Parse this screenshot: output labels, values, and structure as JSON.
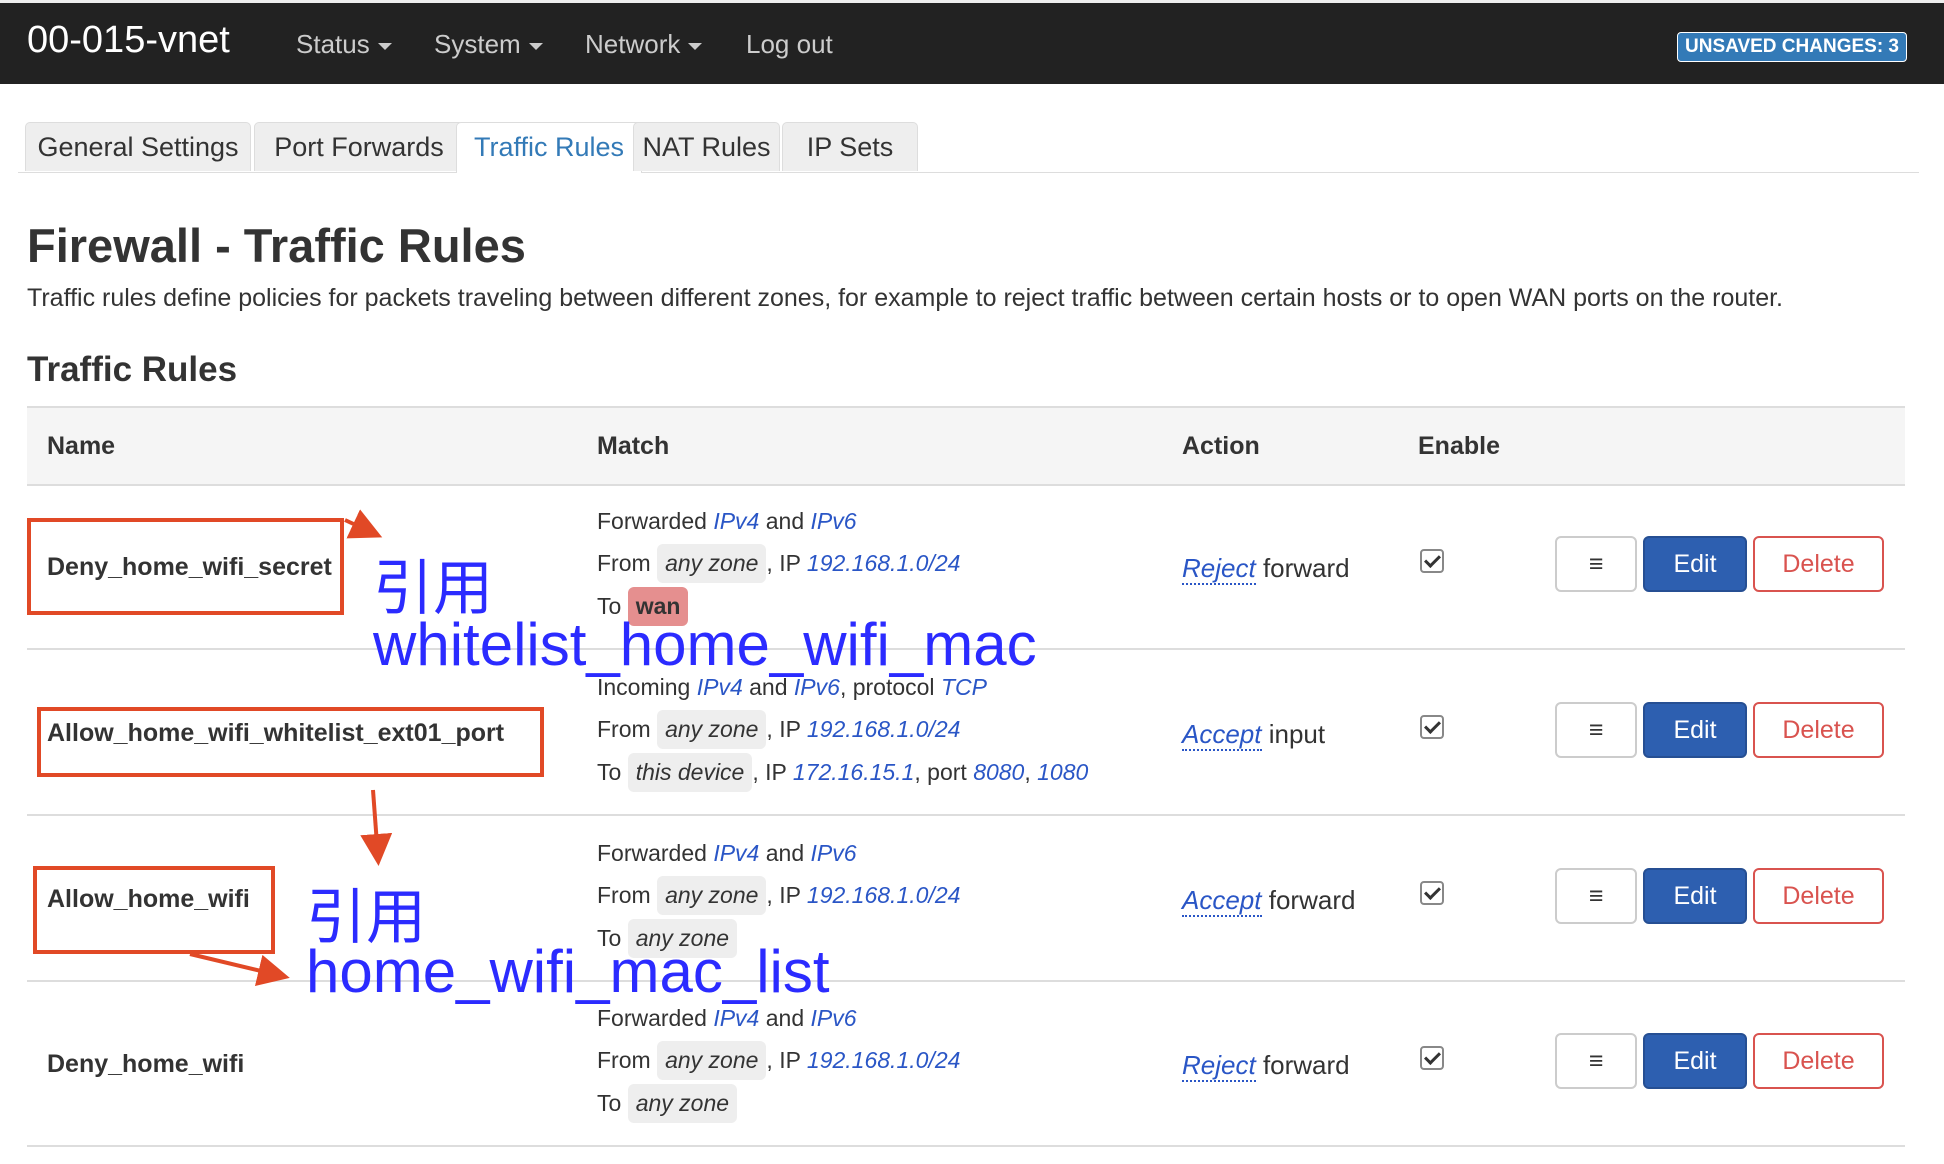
{
  "navbar": {
    "brand": "00-015-vnet",
    "menus": [
      "Status",
      "System",
      "Network"
    ],
    "logout": "Log out",
    "unsaved": "UNSAVED CHANGES: 3"
  },
  "tabs": [
    "General Settings",
    "Port Forwards",
    "Traffic Rules",
    "NAT Rules",
    "IP Sets"
  ],
  "active_tab": "Traffic Rules",
  "page": {
    "title": "Firewall - Traffic Rules",
    "description": "Traffic rules define policies for packets traveling between different zones, for example to reject traffic between certain hosts or to open WAN ports on the router.",
    "section_title": "Traffic Rules"
  },
  "table": {
    "headers": [
      "Name",
      "Match",
      "Action",
      "Enable"
    ],
    "rows": [
      {
        "name": "Deny_home_wifi_secret",
        "match": {
          "l1": {
            "prefix": "Forwarded",
            "a": "IPv4",
            "mid": "and",
            "b": "IPv6"
          },
          "l2": {
            "from": "From",
            "zone": "any zone",
            "ip_label": ", IP",
            "ip": "192.168.1.0/24"
          },
          "l3": {
            "to": "To",
            "zone": "wan"
          }
        },
        "action": {
          "verb": "Reject",
          "rest": "forward"
        },
        "enabled": true
      },
      {
        "name": "Allow_home_wifi_whitelist_ext01_port",
        "match": {
          "l1": {
            "prefix": "Incoming",
            "a": "IPv4",
            "mid": "and",
            "b": "IPv6",
            "proto_label": ", protocol",
            "proto": "TCP"
          },
          "l2": {
            "from": "From",
            "zone": "any zone",
            "ip_label": ", IP",
            "ip": "192.168.1.0/24"
          },
          "l3": {
            "to": "To",
            "zone": "this device",
            "ip_label": ", IP",
            "ip": "172.16.15.1",
            "port_label": ", port",
            "port1": "8080",
            "sep": ",",
            "port2": "1080"
          }
        },
        "action": {
          "verb": "Accept",
          "rest": "input"
        },
        "enabled": true
      },
      {
        "name": "Allow_home_wifi",
        "match": {
          "l1": {
            "prefix": "Forwarded",
            "a": "IPv4",
            "mid": "and",
            "b": "IPv6"
          },
          "l2": {
            "from": "From",
            "zone": "any zone",
            "ip_label": ", IP",
            "ip": "192.168.1.0/24"
          },
          "l3": {
            "to": "To",
            "zone": "any zone"
          }
        },
        "action": {
          "verb": "Accept",
          "rest": "forward"
        },
        "enabled": true
      },
      {
        "name": "Deny_home_wifi",
        "match": {
          "l1": {
            "prefix": "Forwarded",
            "a": "IPv4",
            "mid": "and",
            "b": "IPv6"
          },
          "l2": {
            "from": "From",
            "zone": "any zone",
            "ip_label": ", IP",
            "ip": "192.168.1.0/24"
          },
          "l3": {
            "to": "To",
            "zone": "any zone"
          }
        },
        "action": {
          "verb": "Reject",
          "rest": "forward"
        },
        "enabled": true
      }
    ],
    "buttons": {
      "menu": "≡",
      "edit": "Edit",
      "delete": "Delete"
    }
  },
  "annotations": {
    "a1_line1": "引用",
    "a1_line2": "whitelist_home_wifi_mac",
    "a2_line1": "引用",
    "a2_line2": "home_wifi_mac_list",
    "color": "#2b2bff",
    "box_color": "#e14926"
  },
  "icons": {
    "caret": "chevron-down-icon",
    "menu": "hamburger-icon",
    "check": "check-icon"
  }
}
